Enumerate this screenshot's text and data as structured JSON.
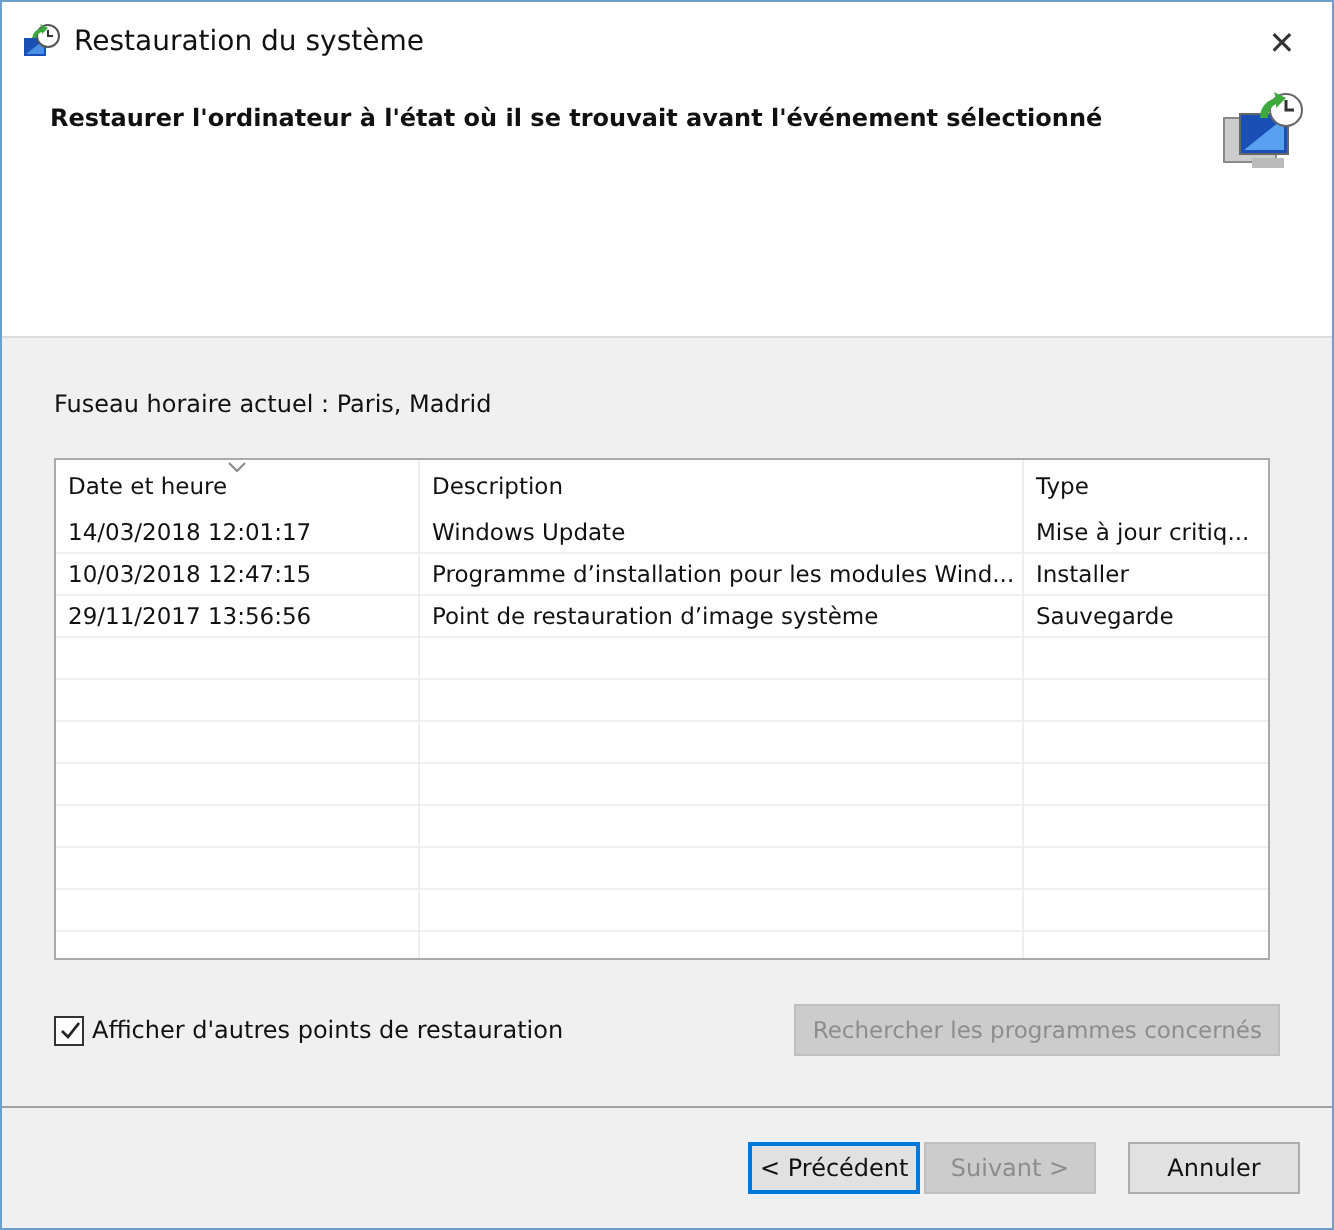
{
  "window": {
    "title": "Restauration du système",
    "close": "✕"
  },
  "header": {
    "heading": "Restaurer l'ordinateur à l'état où il se trouvait avant l'événement sélectionné"
  },
  "timezone": "Fuseau horaire actuel : Paris, Madrid",
  "table": {
    "columns": [
      {
        "label": "Date et heure",
        "sorted": true
      },
      {
        "label": "Description",
        "sorted": false
      },
      {
        "label": "Type",
        "sorted": false
      }
    ],
    "rows": [
      {
        "cells": [
          "14/03/2018 12:01:17",
          "Windows Update",
          "Mise à jour critiq..."
        ]
      },
      {
        "cells": [
          "10/03/2018 12:47:15",
          "Programme d’installation pour les modules Wind...",
          "Installer"
        ]
      },
      {
        "cells": [
          "29/11/2017 13:56:56",
          "Point de restauration d’image système",
          "Sauvegarde"
        ]
      }
    ]
  },
  "show_more": {
    "label": "Afficher d'autres points de restauration",
    "checked": true
  },
  "scan_button": {
    "label": "Rechercher les programmes concernés",
    "disabled": true
  },
  "buttons": [
    {
      "label": "< Précédent",
      "disabled": false,
      "focused": true
    },
    {
      "label": "Suivant >",
      "disabled": true,
      "focused": false
    },
    {
      "label": "Annuler",
      "disabled": false,
      "focused": false
    }
  ]
}
